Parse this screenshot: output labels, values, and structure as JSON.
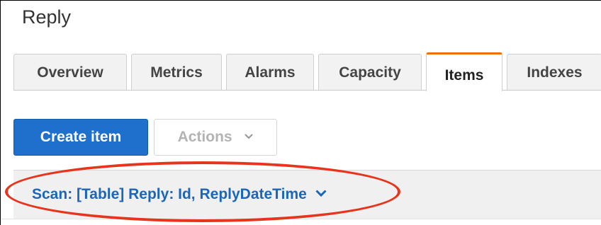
{
  "page": {
    "title": "Reply"
  },
  "tabs": [
    {
      "label": "Overview",
      "active": false
    },
    {
      "label": "Metrics",
      "active": false
    },
    {
      "label": "Alarms",
      "active": false
    },
    {
      "label": "Capacity",
      "active": false
    },
    {
      "label": "Items",
      "active": true
    },
    {
      "label": "Indexes",
      "active": false
    }
  ],
  "toolbar": {
    "create_label": "Create item",
    "actions_label": "Actions",
    "actions_icon": "chevron-down-icon"
  },
  "scan": {
    "label": "Scan: [Table] Reply: Id, ReplyDateTime",
    "icon": "chevron-down-icon"
  },
  "colors": {
    "primary": "#1f6fcc",
    "active_tab_accent": "#ec7211",
    "link": "#1a66b8",
    "annotation": "#e8341c"
  }
}
